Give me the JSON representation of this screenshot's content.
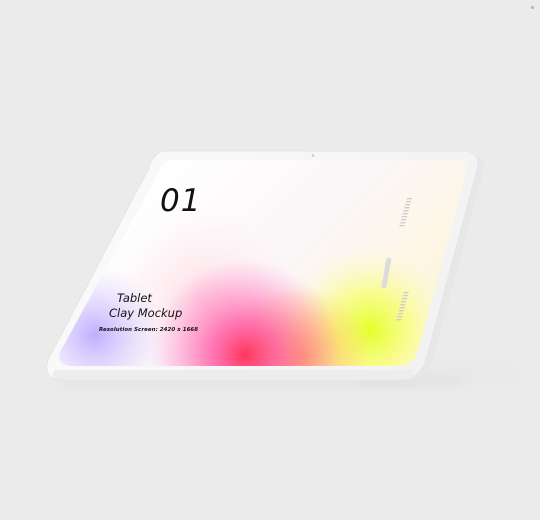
{
  "mockup": {
    "number": "01",
    "title_line1": "Tablet",
    "title_line2": "Clay Mockup",
    "resolution": "Resolution Screen: 2420 x 1668"
  },
  "colors": {
    "background": "#ebebeb",
    "device_body": "#f6f6f6",
    "gradient_pink": "#ff3fa6",
    "gradient_orange": "#ff8a3d",
    "gradient_yellow": "#e9ff3a",
    "gradient_lilac": "#c9b8ff"
  }
}
